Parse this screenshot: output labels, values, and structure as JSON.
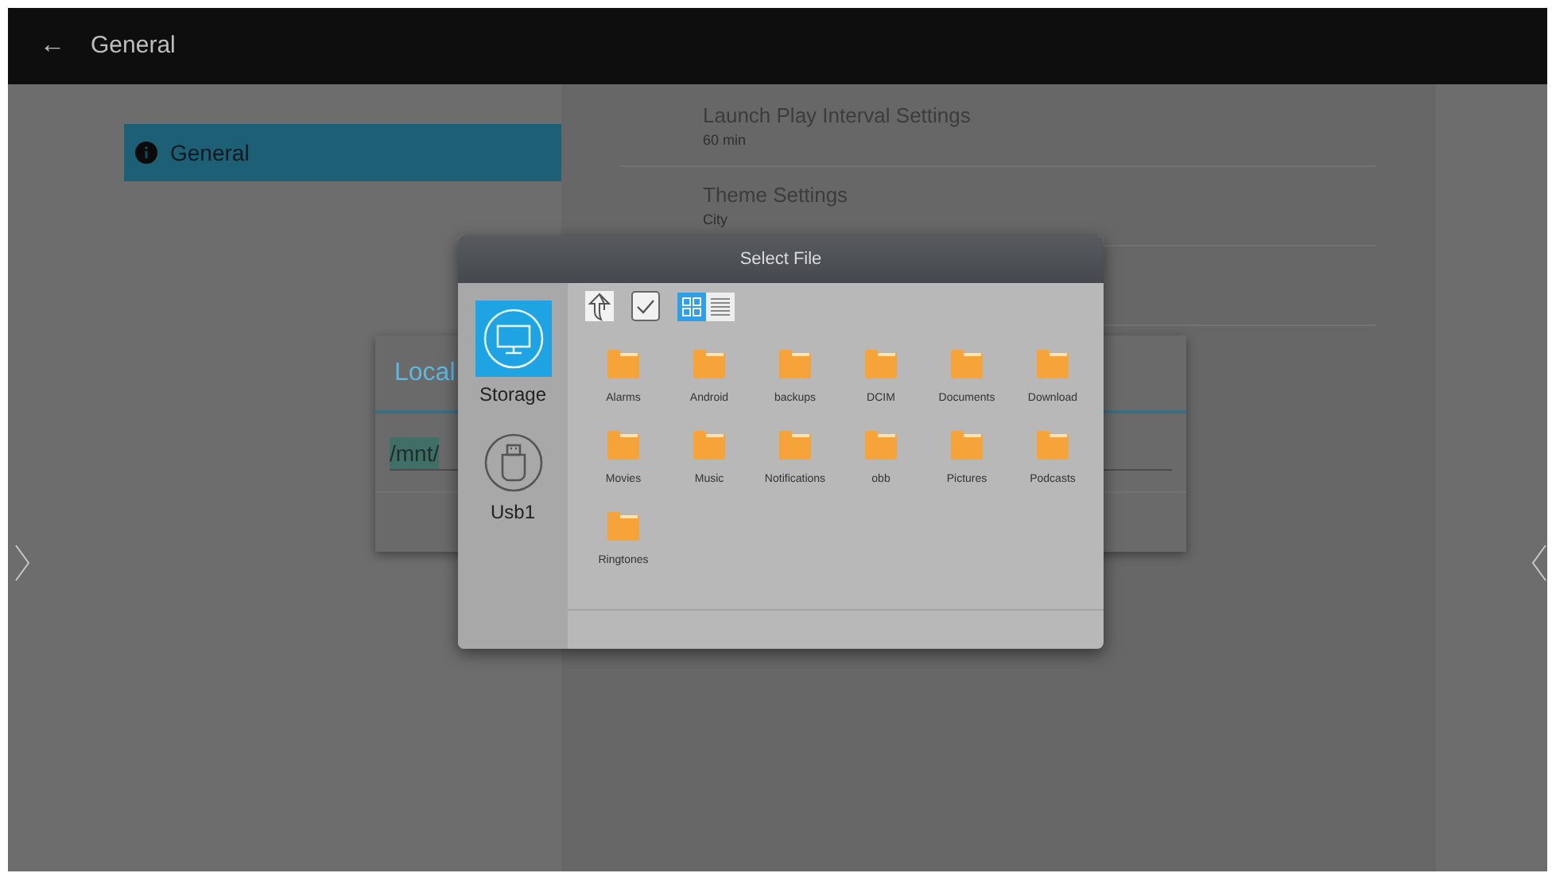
{
  "app_bar": {
    "back": "←",
    "title": "General"
  },
  "sidebar": {
    "items": [
      {
        "label": "General",
        "selected": true
      }
    ]
  },
  "settings": [
    {
      "title": "Launch Play Interval Settings",
      "value": "60 min"
    },
    {
      "title": "Theme Settings",
      "value": "City"
    }
  ],
  "background_dialog": {
    "title": "Local",
    "path": "/mnt/"
  },
  "file_dialog": {
    "title": "Select File",
    "devices": [
      {
        "label": "Storage",
        "kind": "storage",
        "selected": true
      },
      {
        "label": "Usb1",
        "kind": "usb",
        "selected": false
      }
    ],
    "view_modes": [
      {
        "kind": "grid",
        "selected": true
      },
      {
        "kind": "list",
        "selected": false
      }
    ],
    "folders": [
      "Alarms",
      "Android",
      "backups",
      "DCIM",
      "Documents",
      "Download",
      "Movies",
      "Music",
      "Notifications",
      "obb",
      "Pictures",
      "Podcasts",
      "Ringtones"
    ]
  }
}
